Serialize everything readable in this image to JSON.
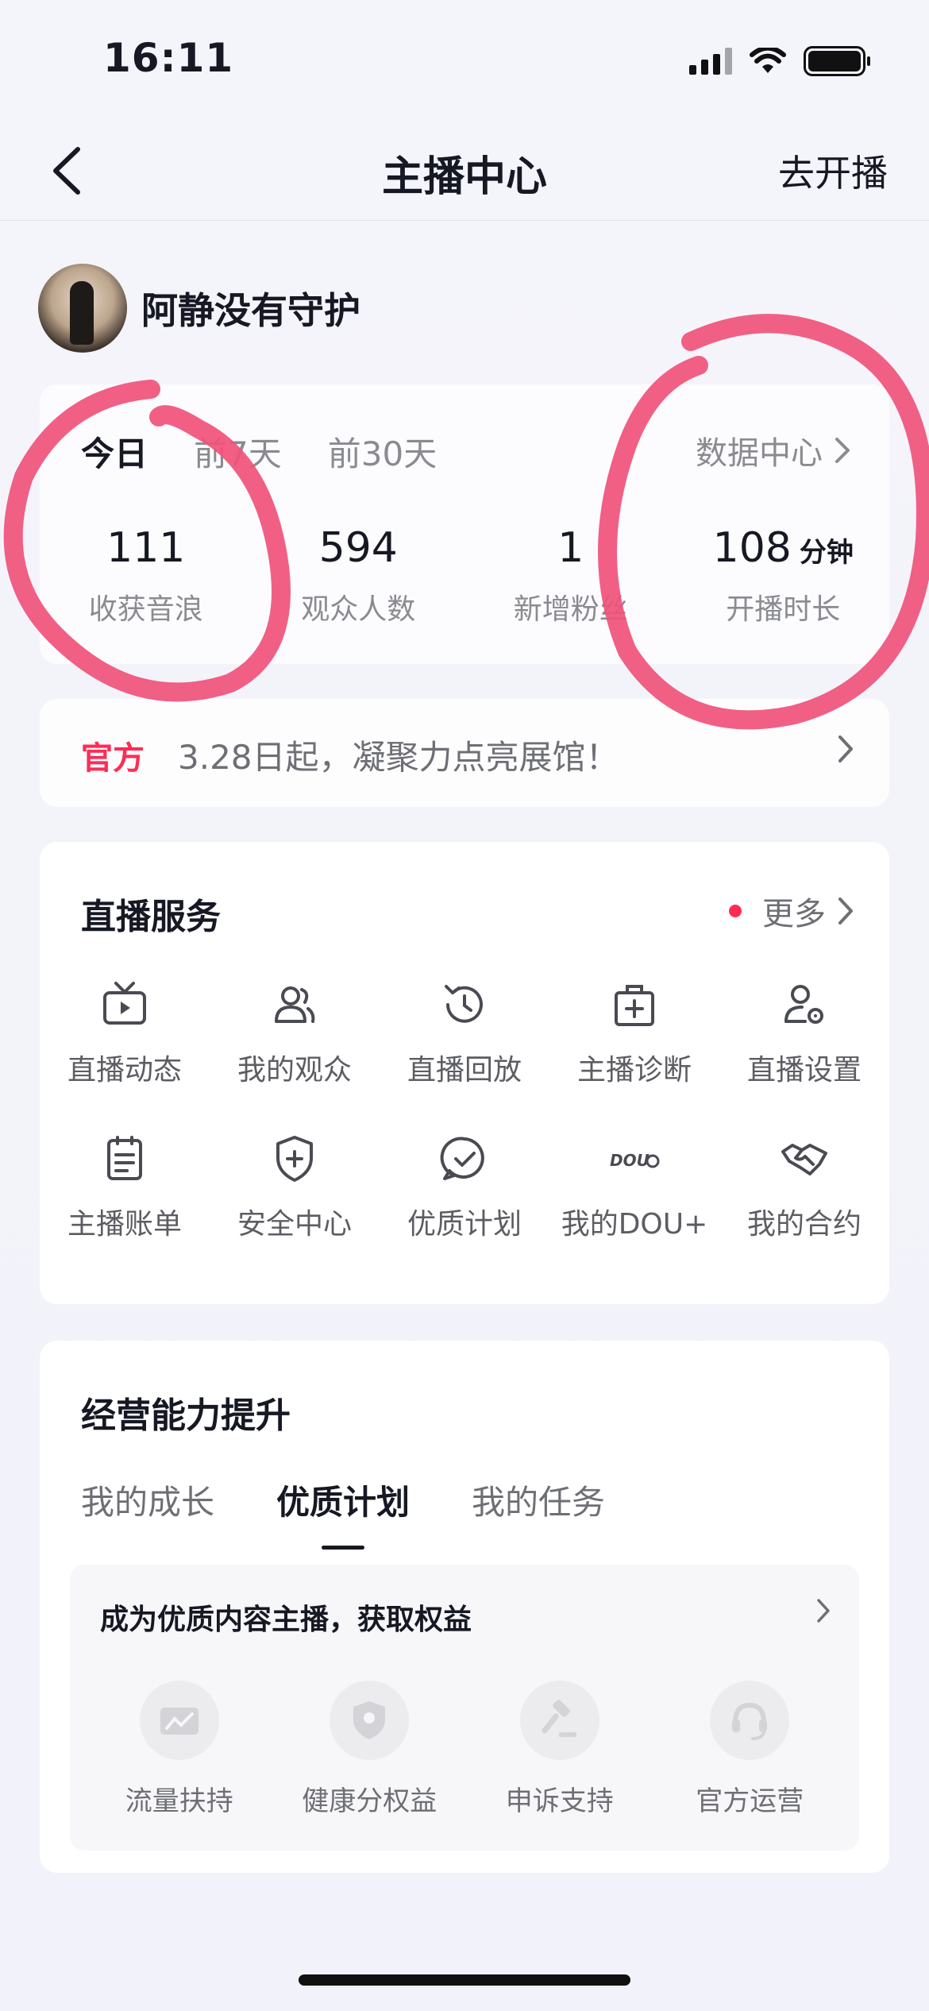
{
  "status_bar": {
    "time": "16:11",
    "icons": [
      "signal-icon",
      "wifi-icon",
      "battery-icon"
    ]
  },
  "nav": {
    "title": "主播中心",
    "action": "去开播",
    "back_icon": "chevron-left-icon"
  },
  "profile": {
    "name": "阿静没有守护"
  },
  "stats_card": {
    "tabs": [
      {
        "label": "今日",
        "active": true
      },
      {
        "label": "前7天",
        "active": false
      },
      {
        "label": "前30天",
        "active": false
      }
    ],
    "data_center_label": "数据中心",
    "stats": [
      {
        "value": "111",
        "unit": "",
        "label": "收获音浪"
      },
      {
        "value": "594",
        "unit": "",
        "label": "观众人数"
      },
      {
        "value": "1",
        "unit": "",
        "label": "新增粉丝"
      },
      {
        "value": "108",
        "unit": "分钟",
        "label": "开播时长"
      }
    ]
  },
  "notice": {
    "tag": "官方",
    "text": "3.28日起，凝聚力点亮展馆！"
  },
  "live_services": {
    "title": "直播服务",
    "more_label": "更多",
    "items": [
      {
        "label": "直播动态",
        "icon": "tv-icon"
      },
      {
        "label": "我的观众",
        "icon": "audience-icon"
      },
      {
        "label": "直播回放",
        "icon": "replay-icon"
      },
      {
        "label": "主播诊断",
        "icon": "medical-kit-icon"
      },
      {
        "label": "直播设置",
        "icon": "user-settings-icon"
      },
      {
        "label": "主播账单",
        "icon": "bill-icon"
      },
      {
        "label": "安全中心",
        "icon": "shield-plus-icon"
      },
      {
        "label": "优质计划",
        "icon": "check-bubble-icon"
      },
      {
        "label": "我的DOU+",
        "icon": "dou-plus-icon"
      },
      {
        "label": "我的合约",
        "icon": "handshake-icon"
      }
    ]
  },
  "business": {
    "title": "经营能力提升",
    "tabs": [
      {
        "label": "我的成长",
        "active": false
      },
      {
        "label": "优质计划",
        "active": true
      },
      {
        "label": "我的任务",
        "active": false
      }
    ],
    "panel_title": "成为优质内容主播，获取权益",
    "benefits": [
      {
        "label": "流量扶持",
        "icon": "traffic-chart-icon"
      },
      {
        "label": "健康分权益",
        "icon": "shield-icon"
      },
      {
        "label": "申诉支持",
        "icon": "gavel-icon"
      },
      {
        "label": "官方运营",
        "icon": "headset-icon"
      }
    ]
  },
  "colors": {
    "accent": "#fe2c55",
    "annotation": "#f0537a",
    "text": "#161823",
    "muted": "#8a8b91"
  }
}
